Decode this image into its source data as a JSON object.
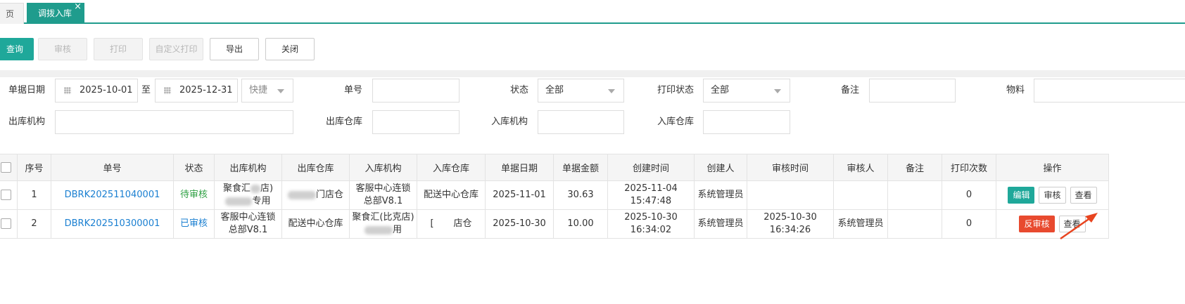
{
  "tabs": {
    "home_label": "页",
    "active_label": "调拨入库",
    "close_glyph": "×"
  },
  "toolbar": {
    "query": "查询",
    "review": "审核",
    "print": "打印",
    "custom_print": "自定义打印",
    "export": "导出",
    "close": "关闭"
  },
  "filters": {
    "date_label": "单据日期",
    "date_from": "2025-10-01",
    "to_label": "至",
    "date_to": "2025-12-31",
    "quick_label": "快捷",
    "number_label": "单号",
    "status_label": "状态",
    "status_value": "全部",
    "print_status_label": "打印状态",
    "print_status_value": "全部",
    "remark_label": "备注",
    "material_label": "物料",
    "out_org_label": "出库机构",
    "out_wh_label": "出库仓库",
    "in_org_label": "入库机构",
    "in_wh_label": "入库仓库"
  },
  "table": {
    "headers": [
      "序号",
      "单号",
      "状态",
      "出库机构",
      "出库仓库",
      "入库机构",
      "入库仓库",
      "单据日期",
      "单据金额",
      "创建时间",
      "创建人",
      "审核时间",
      "审核人",
      "备注",
      "打印次数",
      "操作"
    ],
    "rows": [
      {
        "seq": "1",
        "number": "DBRK202511040001",
        "status": "待审核",
        "out_org_a": "聚食汇",
        "out_org_b": "店)",
        "out_org_c": "专用",
        "out_wh": "门店仓",
        "in_org_1": "客服中心连锁",
        "in_org_2": "总部V8.1",
        "in_wh": "配送中心仓库",
        "date": "2025-11-01",
        "amount": "30.63",
        "created_1": "2025-11-04",
        "created_2": "15:47:48",
        "creator": "系统管理员",
        "reviewed_1": "",
        "reviewed_2": "",
        "reviewer": "",
        "remark": "",
        "print_count": "0",
        "ops": [
          "编辑",
          "审核",
          "查看"
        ]
      },
      {
        "seq": "2",
        "number": "DBRK202510300001",
        "status": "已审核",
        "out_org_1": "客服中心连锁",
        "out_org_2": "总部V8.1",
        "out_wh": "配送中心仓库",
        "in_org_a": "聚食汇(比克店)",
        "in_org_b": "用",
        "in_wh_a": "[",
        "in_wh_b": "店仓",
        "date": "2025-10-30",
        "amount": "10.00",
        "created_1": "2025-10-30",
        "created_2": "16:34:02",
        "creator": "系统管理员",
        "reviewed_1": "2025-10-30",
        "reviewed_2": "16:34:26",
        "reviewer": "系统管理员",
        "remark": "",
        "print_count": "0",
        "ops": [
          "反审核",
          "查看"
        ]
      }
    ]
  },
  "colors": {
    "accent": "#1fa89a",
    "danger": "#e84a2f",
    "link": "#1a7fd1",
    "pending": "#2ea043"
  }
}
